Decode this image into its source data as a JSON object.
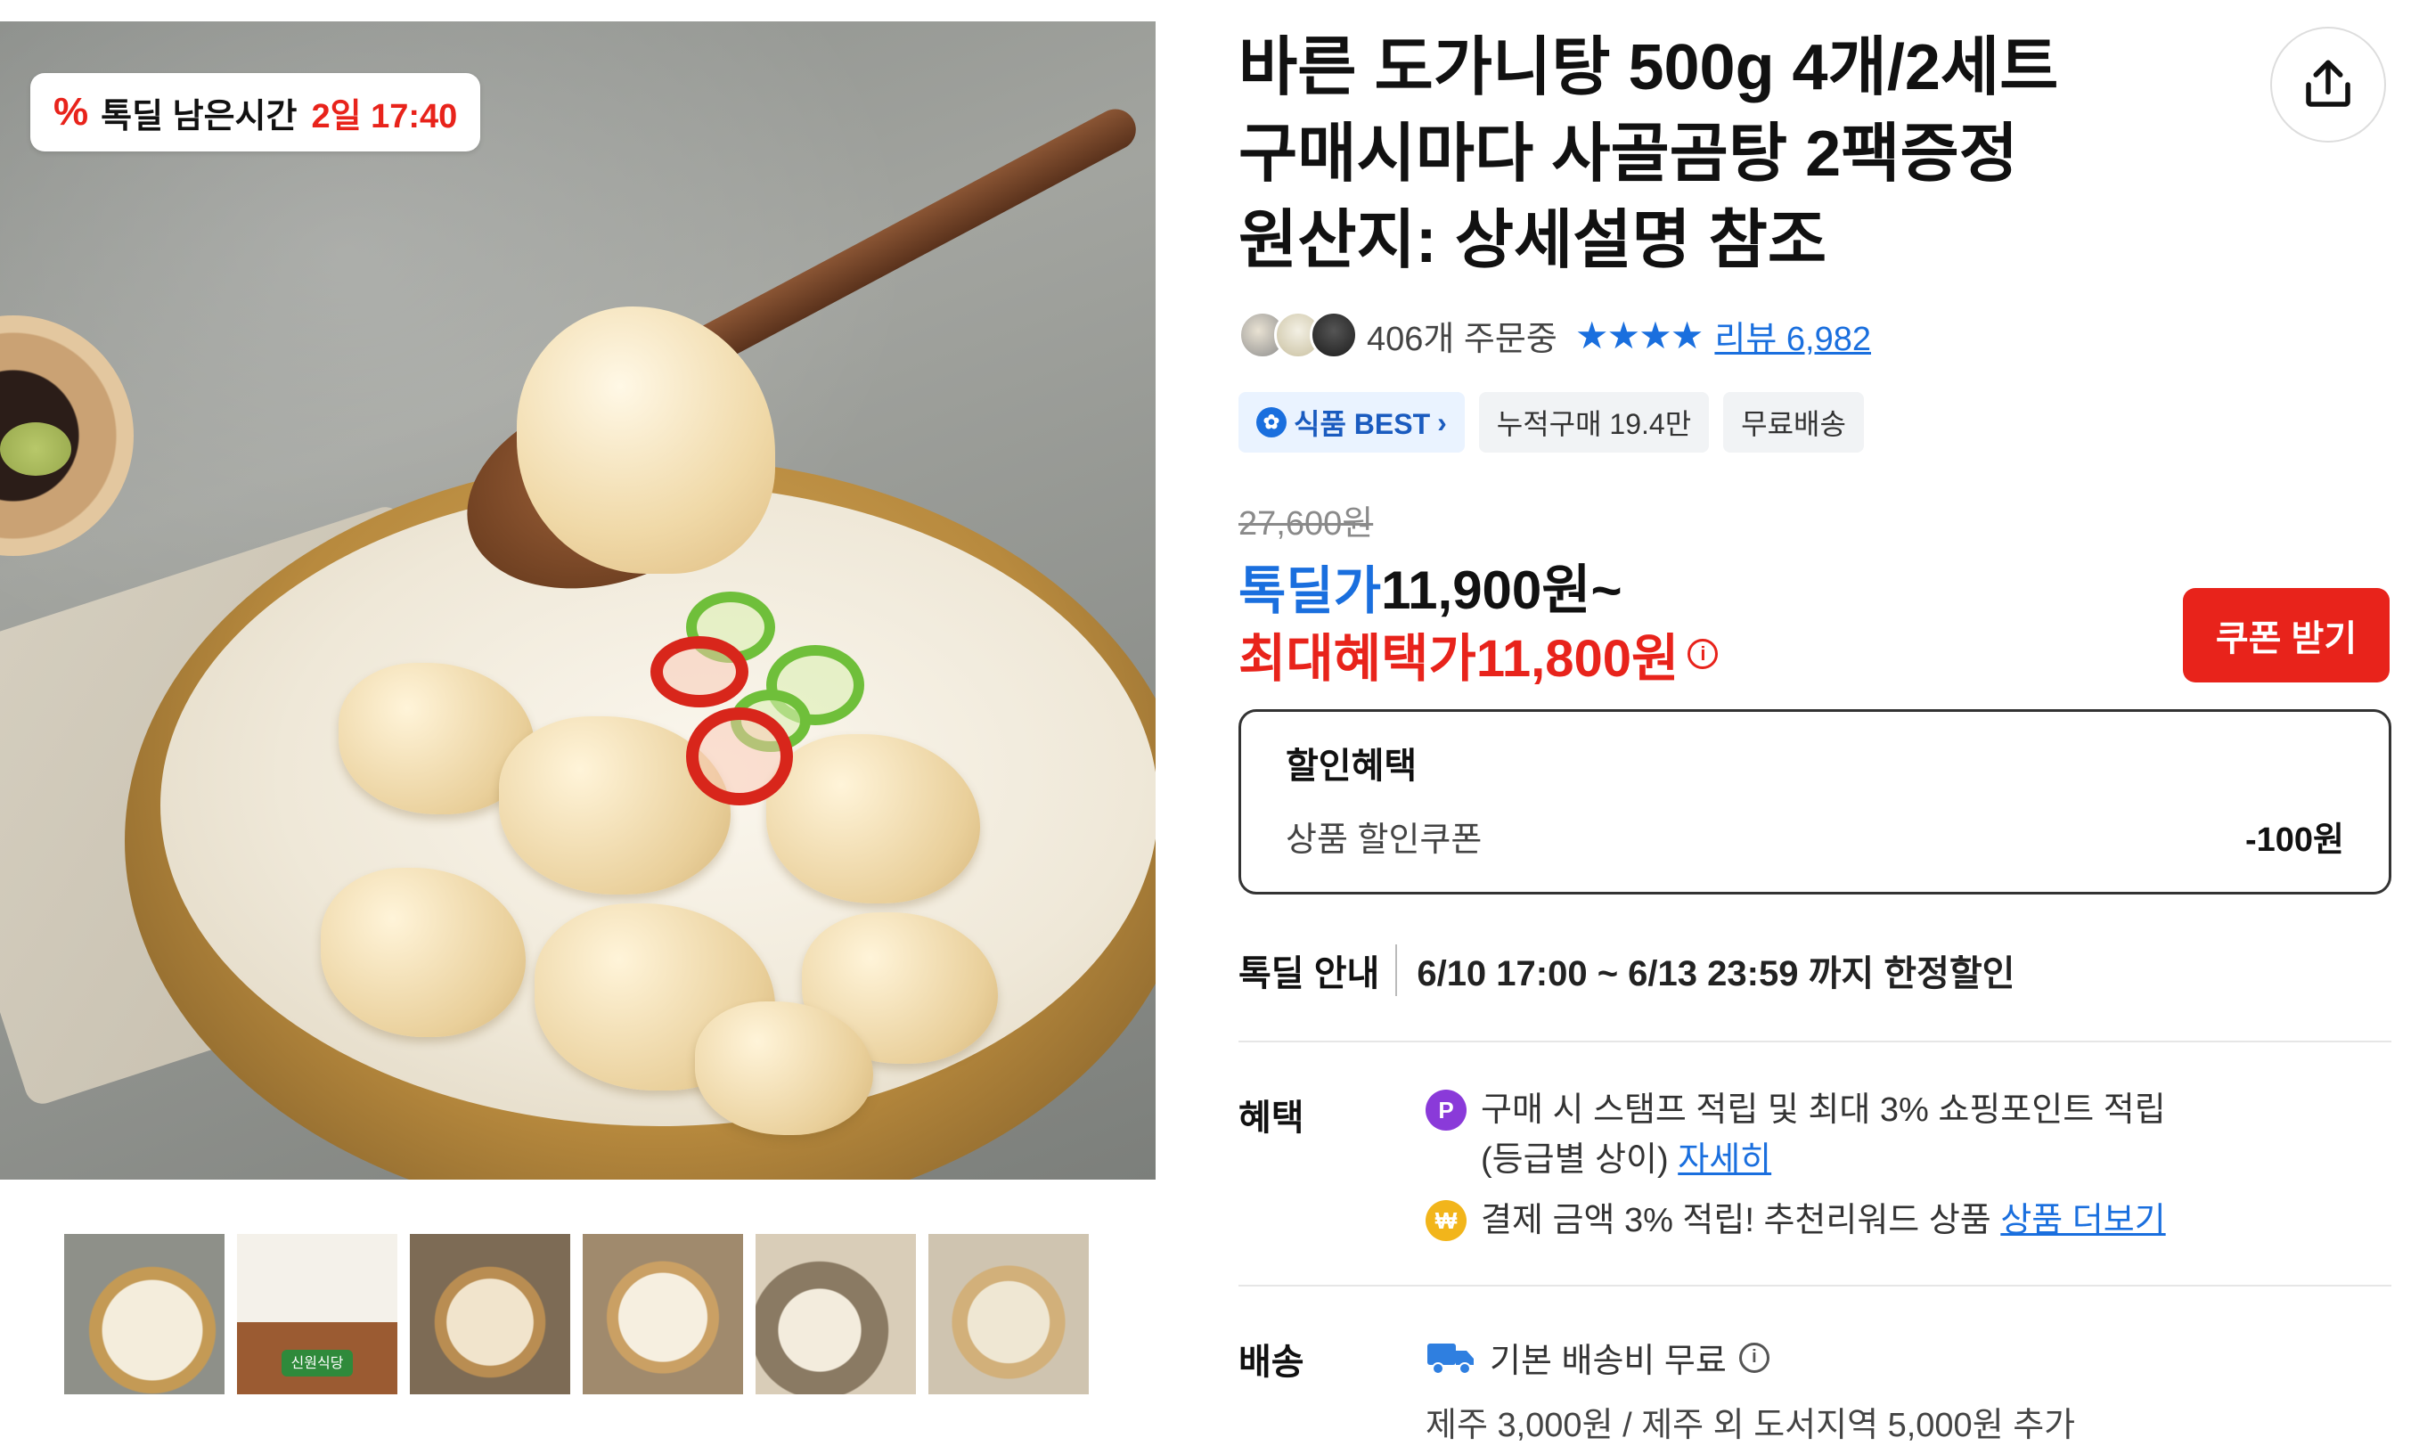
{
  "deal_badge": {
    "icon": "percent-icon",
    "label": "톡딜 남은시간",
    "time": "2일 17:40"
  },
  "product": {
    "title_lines": [
      "바른 도가니탕 500g 4개/2세트",
      "구매시마다 사골곰탕 2팩증정",
      "원산지: 상세설명 참조"
    ]
  },
  "stats": {
    "orders": "406개 주문중",
    "stars": "★★★★",
    "review_link": "리뷰 6,982"
  },
  "chips": {
    "best": "식품 BEST",
    "cumulative": "누적구매 19.4만",
    "free_shipping": "무료배송"
  },
  "price": {
    "original": "27,600원",
    "deal_label": "톡딜가",
    "deal_value": "11,900원~",
    "max_label": "최대혜택가",
    "max_value": "11,800원",
    "coupon_button": "쿠폰 받기"
  },
  "discount_box": {
    "header": "할인혜택",
    "row_label": "상품 할인쿠폰",
    "row_amount": "-100원"
  },
  "deal_info": {
    "label": "톡딜 안내",
    "value": "6/10 17:00 ~ 6/13 23:59 까지 한정할인"
  },
  "benefits": {
    "label": "혜택",
    "point_icon": "P",
    "line1_text": "구매 시 스탬프 적립 및 최대 3% 쇼핑포인트 적립",
    "line1_text2": "(등급별 상이)",
    "line1_link": "자세히",
    "line2_text": "결제 금액 3% 적립! 추천리워드 상품",
    "line2_link": "상품 더보기"
  },
  "shipping": {
    "label": "배송",
    "main": "기본 배송비 무료",
    "sub": "제주 3,000원 / 제주 외 도서지역 5,000원 추가"
  },
  "thumbnails": {
    "count": 6,
    "active_index": 0,
    "t2_sign": "신원식당"
  },
  "colors": {
    "accent_blue": "#1a6fde",
    "accent_red": "#e8231b"
  }
}
